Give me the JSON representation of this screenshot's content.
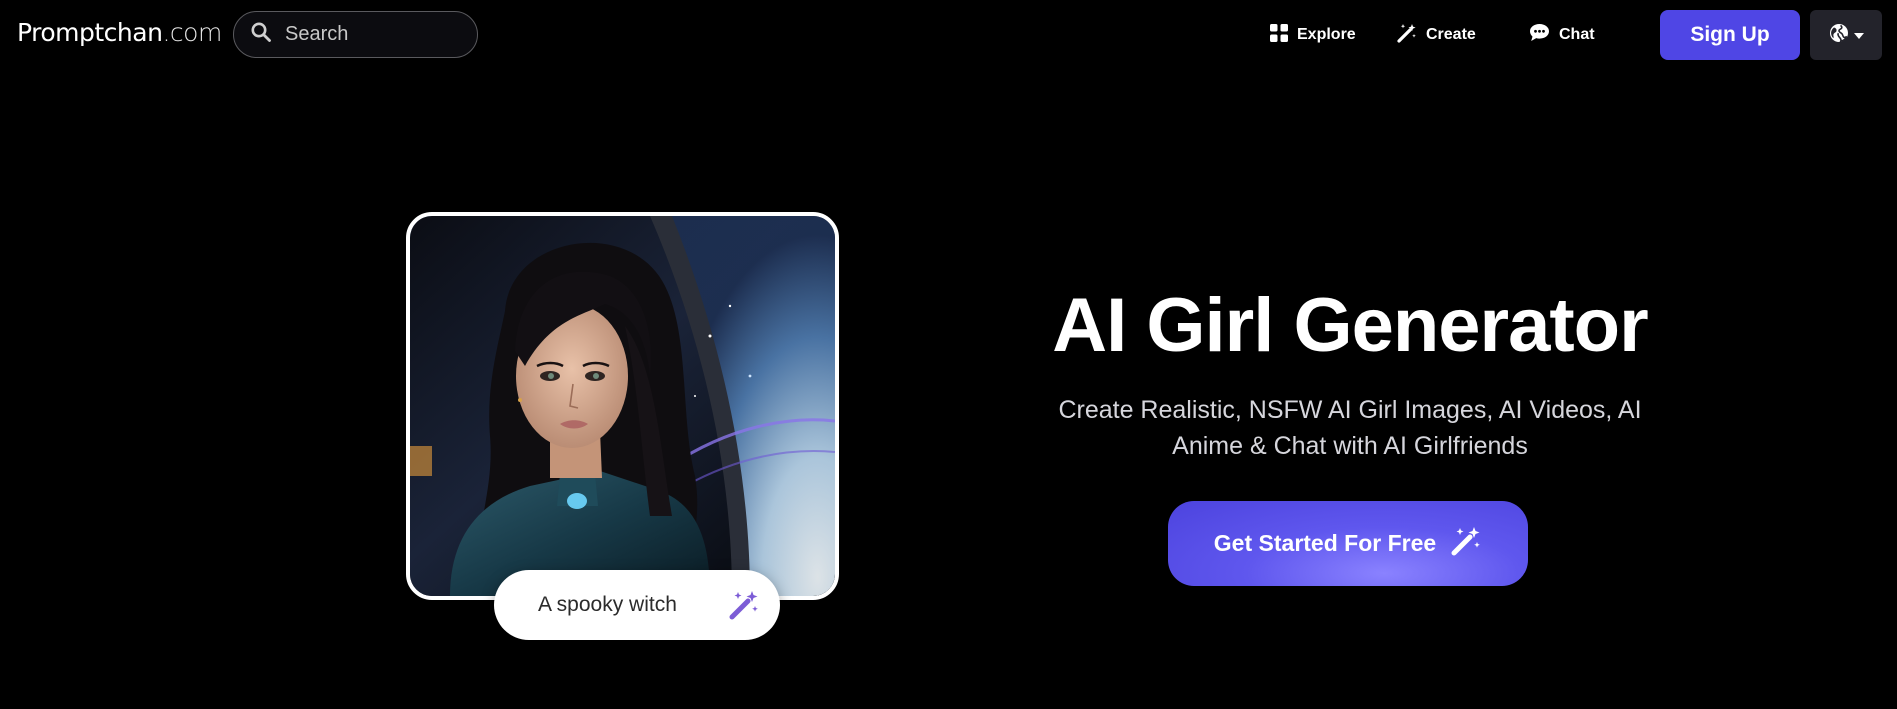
{
  "header": {
    "logo": {
      "brand": "Promptchan",
      "tld": ".com"
    },
    "search": {
      "placeholder": "Search",
      "icon": "search-icon"
    },
    "nav": [
      {
        "label": "Explore",
        "icon": "grid-icon"
      },
      {
        "label": "Create",
        "icon": "magic-wand-icon"
      },
      {
        "label": "Chat",
        "icon": "chat-bubble-icon"
      }
    ],
    "signup_label": "Sign Up",
    "language": {
      "icon": "globe-icon",
      "caret": "caret-down-icon"
    }
  },
  "hero": {
    "title": "AI Girl Generator",
    "subtitle": "Create Realistic, NSFW AI Girl Images, AI Videos, AI Anime & Chat with AI Girlfriends",
    "cta_label": "Get Started For Free",
    "cta_icon": "magic-wand-icon",
    "prompt_text": "A spooky witch",
    "prompt_icon": "magic-wand-icon"
  },
  "colors": {
    "background": "#000000",
    "accent": "#4f46e5",
    "cta_highlight": "#8a82ff",
    "wand_purple": "#7c5cd6",
    "search_border": "#5a5a5e",
    "language_bg": "#23232b"
  }
}
